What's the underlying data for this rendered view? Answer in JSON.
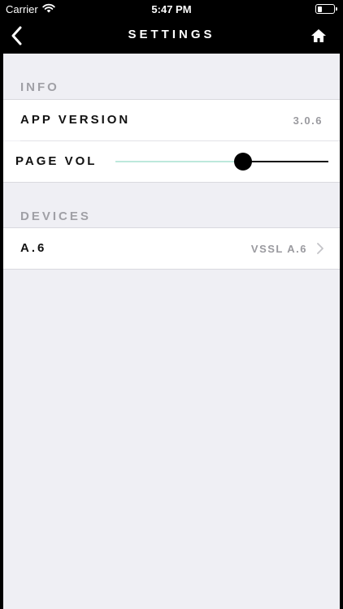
{
  "status_bar": {
    "carrier": "Carrier",
    "time": "5:47 PM",
    "wifi_icon": "wifi-icon",
    "battery_icon": "battery-icon",
    "battery_level": 0.3
  },
  "nav": {
    "title": "SETTINGS",
    "back_icon": "chevron-left-icon",
    "home_icon": "home-icon"
  },
  "info": {
    "header": "INFO",
    "app_version_label": "APP VERSION",
    "app_version_value": "3.0.6",
    "page_vol_label": "PAGE VOL",
    "page_vol_level": 0.6
  },
  "devices": {
    "header": "DEVICES",
    "items": [
      {
        "label": "A.6",
        "value": "VSSL A.6"
      }
    ]
  },
  "colors": {
    "bar_bg": "#000000",
    "content_bg": "#efeff4",
    "slider_fill": "#bde8dc",
    "header_text": "#a0a0a6"
  }
}
